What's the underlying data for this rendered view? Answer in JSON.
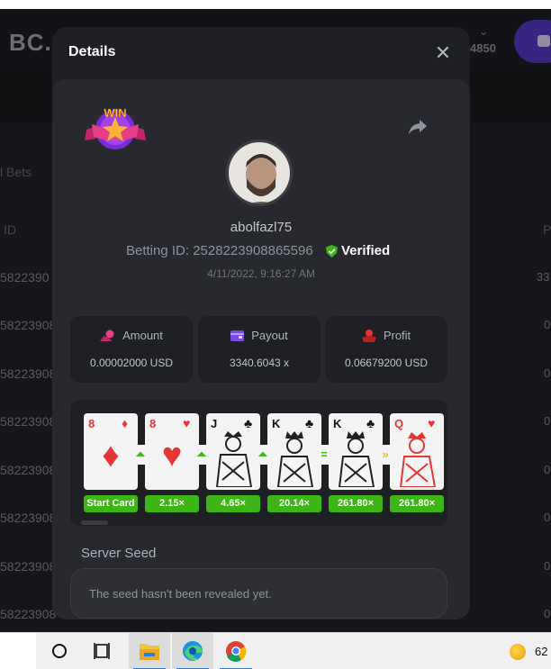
{
  "background": {
    "logo": "BC.",
    "balance": "4850",
    "tab_label": "l Bets",
    "column_id": "ID",
    "column_right": "P",
    "row_ids": [
      "5822390",
      "58223908",
      "58223908",
      "58223908",
      "58223908",
      "58223908",
      "58223908",
      "58223908"
    ],
    "row_right": [
      "33",
      "0",
      "0",
      "0",
      "0",
      "0",
      "0",
      "0"
    ]
  },
  "modal": {
    "title": "Details",
    "close_icon": "close-icon",
    "badge_text": "WIN",
    "username": "abolfazl75",
    "betting_id": "Betting ID: 2528223908865596",
    "verified": "Verified",
    "datetime": "4/11/2022, 9:16:27 AM",
    "stats": [
      {
        "label": "Amount",
        "value": "0.00002000 USD",
        "icon": "coins-icon",
        "color": "#e8407a"
      },
      {
        "label": "Payout",
        "value": "3340.6043 x",
        "icon": "wallet-icon",
        "color": "#7a4be0"
      },
      {
        "label": "Profit",
        "value": "0.06679200 USD",
        "icon": "profit-icon",
        "color": "#e53636"
      }
    ],
    "cards": [
      {
        "rank": "8",
        "suit": "♦",
        "color": "red",
        "face": false,
        "multiplier": "Start Card"
      },
      {
        "rank": "8",
        "suit": "♥",
        "color": "red",
        "face": false,
        "multiplier": "2.15×"
      },
      {
        "rank": "J",
        "suit": "♣",
        "color": "blk",
        "face": true,
        "multiplier": "4.65×"
      },
      {
        "rank": "K",
        "suit": "♣",
        "color": "blk",
        "face": true,
        "multiplier": "20.14×"
      },
      {
        "rank": "K",
        "suit": "♣",
        "color": "blk",
        "face": true,
        "multiplier": "261.80×"
      },
      {
        "rank": "Q",
        "suit": "♥",
        "color": "red",
        "face": true,
        "multiplier": "261.80×"
      }
    ],
    "arrows": [
      "⏶",
      "⏶",
      "⏶",
      "=",
      "»"
    ],
    "seed_label": "Server Seed",
    "seed_text": "The seed hasn't been revealed yet."
  },
  "taskbar": {
    "items": [
      "cortana-circle-icon",
      "task-view-icon",
      "file-explorer-icon",
      "edge-icon",
      "chrome-icon"
    ],
    "tray_text": "62"
  }
}
